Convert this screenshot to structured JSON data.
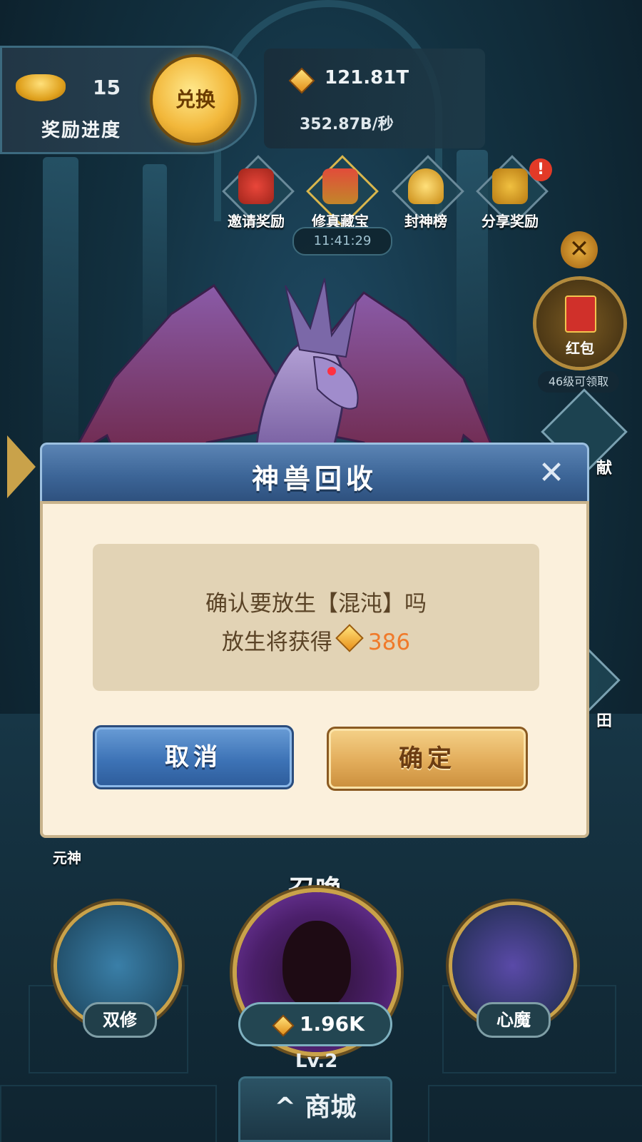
{
  "hud": {
    "ingot_count": "15",
    "reward_progress_label": "奖励进度",
    "exchange_label": "兑换",
    "gold_total": "121.81T",
    "gold_rate": "352.87B/秒"
  },
  "top_icons": [
    {
      "label": "邀请奖励",
      "icon": "invite-reward-icon"
    },
    {
      "label": "修真藏宝",
      "icon": "treasure-chest-icon"
    },
    {
      "label": "封神榜",
      "icon": "trophy-cup-icon"
    },
    {
      "label": "分享奖励",
      "icon": "share-reward-icon"
    }
  ],
  "timer": "11:41:29",
  "alert_badge": "!",
  "side": {
    "close_symbol": "✕",
    "red_packet_label": "红包",
    "red_packet_hint": "46级可领取",
    "partial_label_1": "献",
    "partial_label_2": "田",
    "yuanshen_label": "元神"
  },
  "dialog": {
    "title": "神兽回收",
    "close_symbol": "✕",
    "message_line1": "确认要放生【混沌】吗",
    "message_line2_prefix": "放生将获得",
    "reward_amount": "386",
    "cancel_label": "取消",
    "confirm_label": "确定"
  },
  "bottom": {
    "summon_label": "召唤",
    "summon_cost": "1.96K",
    "level": "Lv.2",
    "shop_label": "商城",
    "shop_arrow": "^",
    "dual_cultivation_label": "双修",
    "inner_demon_label": "心魔"
  },
  "colors": {
    "dialog_header": "#3c6597",
    "dialog_body": "#fbf0dc",
    "message_box": "#e2d3b5",
    "reward_amount": "#f07a2a",
    "cancel_button": "#3d73b6",
    "confirm_button": "#e2ac5a"
  }
}
